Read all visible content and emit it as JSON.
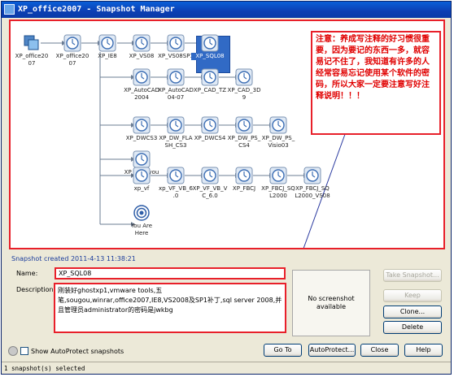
{
  "window": {
    "title": "XP_office2007 - Snapshot Manager"
  },
  "tree": {
    "nodes": [
      {
        "id": "n1",
        "label": "XP_office20\n07",
        "type": "vm"
      },
      {
        "id": "n2",
        "label": "XP_office20\n07",
        "type": "snap"
      },
      {
        "id": "n3",
        "label": "XP_IE8",
        "type": "snap"
      },
      {
        "id": "n4",
        "label": "XP_VS08",
        "type": "snap"
      },
      {
        "id": "n5",
        "label": "XP_VS08SP1",
        "type": "snap"
      },
      {
        "id": "n6",
        "label": "XP_SQL08",
        "type": "snap",
        "selected": true
      },
      {
        "id": "n7",
        "label": "XP_AutoCAD\n2004",
        "type": "snap"
      },
      {
        "id": "n8",
        "label": "XP_AutoCAD\n04-07",
        "type": "snap"
      },
      {
        "id": "n9",
        "label": "XP_CAD_TZ",
        "type": "snap"
      },
      {
        "id": "n10",
        "label": "XP_CAD_3D\n9",
        "type": "snap"
      },
      {
        "id": "n11",
        "label": "XP_DWCS3",
        "type": "snap"
      },
      {
        "id": "n12",
        "label": "XP_DW_FLA\nSH_CS3",
        "type": "snap"
      },
      {
        "id": "n13",
        "label": "XP_DWCS4",
        "type": "snap"
      },
      {
        "id": "n14",
        "label": "XP_DW_PS_\nCS4",
        "type": "snap"
      },
      {
        "id": "n15",
        "label": "XP_DW_PS_\nVisio03",
        "type": "snap"
      },
      {
        "id": "n16",
        "label": "XP_yongyou",
        "type": "snap"
      },
      {
        "id": "n17",
        "label": "xp_vf",
        "type": "snap"
      },
      {
        "id": "n18",
        "label": "xp_VF_VB_6\n.0",
        "type": "snap"
      },
      {
        "id": "n19",
        "label": "XP_VF_VB_V\nC_6.0",
        "type": "snap"
      },
      {
        "id": "n20",
        "label": "XP_FBCJ",
        "type": "snap"
      },
      {
        "id": "n21",
        "label": "XP_FBCJ_SQ\nL2000",
        "type": "snap"
      },
      {
        "id": "n22",
        "label": "XP_FBCJ_SQ\nL2000_VS08",
        "type": "snap"
      },
      {
        "id": "n23",
        "label": "You Are\nHere",
        "type": "here"
      }
    ],
    "note": "注意：养成写注释的好习惯很重要，因为要记的东西一多，就容易记不住了，我知道有许多的人经常容易忘记使用某个软件的密码，所以大家一定要注意写好注释说明！！！"
  },
  "details": {
    "created": "Snapshot created 2011-4-13 11:38:21",
    "name_label": "Name:",
    "name_value": "XP_SQL08",
    "desc_label": "Description:",
    "desc_value": "刚装好ghostxp1,vmware tools,五笔,sougou,winrar,office2007,IE8,VS2008及SP1补丁,sql server 2008,并且管理员administrator的密码是jwkbg",
    "no_screenshot": "No screenshot available"
  },
  "buttons": {
    "take_snapshot": "Take Snapshot...",
    "keep": "Keep",
    "clone": "Clone...",
    "delete": "Delete",
    "go_to": "Go To",
    "autoprotect": "AutoProtect...",
    "close": "Close",
    "help": "Help"
  },
  "footer": {
    "show_autoprotect": "Show AutoProtect snapshots",
    "status": "1 snapshot(s) selected"
  },
  "colors": {
    "selection": "#316ac5",
    "highlight_border": "#e8202a",
    "note_text": "#e00000"
  }
}
